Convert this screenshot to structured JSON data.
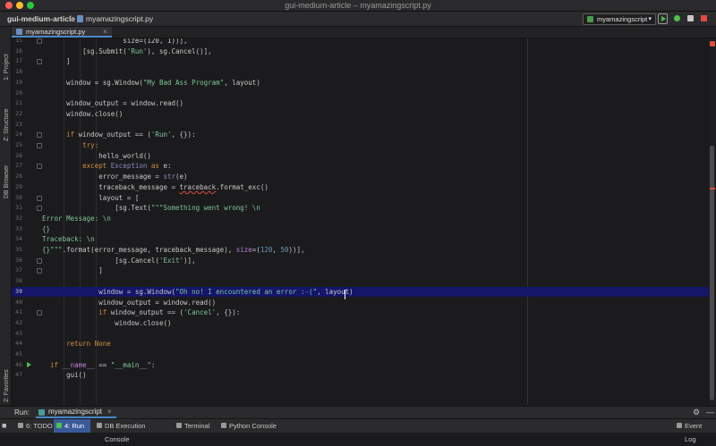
{
  "window": {
    "title": "gui-medium-article – myamazingscript.py"
  },
  "navbar": {
    "project": "gui-medium-article",
    "separator": "〉",
    "file": "myamazingscript.py",
    "run_config": "myamazingscript",
    "run_config_caret": "▾"
  },
  "left_tabs": [
    {
      "label": "1: Project",
      "icon": "folder-icon"
    },
    {
      "label": "Z: Structure",
      "icon": "structure-icon"
    },
    {
      "label": "DB Browser",
      "icon": "database-icon"
    },
    {
      "label": "2: Favorites",
      "icon": "star-icon"
    }
  ],
  "editor_tab": {
    "label": "myamazingscript.py",
    "close": "×"
  },
  "code_lines": [
    {
      "n": "15",
      "segs": [
        [
          "",
          "                    size=(120, 1))],"
        ]
      ]
    },
    {
      "n": "16",
      "segs": [
        [
          "",
          "          [sg.Submit("
        ],
        [
          "str",
          "'Run'"
        ],
        [
          "",
          "), sg.Cancel()],"
        ]
      ]
    },
    {
      "n": "17",
      "segs": [
        [
          "",
          "      ]"
        ]
      ]
    },
    {
      "n": "18",
      "segs": []
    },
    {
      "n": "19",
      "segs": [
        [
          "",
          "      window = sg.Window("
        ],
        [
          "str",
          "\"My Bad Ass Program\""
        ],
        [
          "",
          ", layout)"
        ]
      ]
    },
    {
      "n": "20",
      "segs": []
    },
    {
      "n": "21",
      "segs": [
        [
          "",
          "      window_output = window.read()"
        ]
      ]
    },
    {
      "n": "22",
      "segs": [
        [
          "",
          "      window.close()"
        ]
      ]
    },
    {
      "n": "23",
      "segs": []
    },
    {
      "n": "24",
      "segs": [
        [
          "kw",
          "      if "
        ],
        [
          "",
          "window_output == ("
        ],
        [
          "str",
          "'Run'"
        ],
        [
          "",
          ", {}):"
        ]
      ]
    },
    {
      "n": "25",
      "segs": [
        [
          "kw",
          "          try:"
        ]
      ]
    },
    {
      "n": "26",
      "segs": [
        [
          "",
          "              hello_world()"
        ]
      ]
    },
    {
      "n": "27",
      "segs": [
        [
          "kw",
          "          except "
        ],
        [
          "builtin",
          "Exception"
        ],
        [
          "kw",
          " as "
        ],
        [
          "",
          "e:"
        ]
      ]
    },
    {
      "n": "28",
      "segs": [
        [
          "",
          "              error_message = "
        ],
        [
          "builtin",
          "str"
        ],
        [
          "",
          "(e)"
        ]
      ]
    },
    {
      "n": "29",
      "segs": [
        [
          "",
          "              traceback_message = "
        ],
        [
          "err",
          "traceback"
        ],
        [
          "",
          ".format_exc()"
        ]
      ]
    },
    {
      "n": "30",
      "segs": [
        [
          "",
          "              layout = ["
        ]
      ]
    },
    {
      "n": "31",
      "segs": [
        [
          "",
          "                  [sg.Text("
        ],
        [
          "str",
          "\"\"\"Something went wrong! \\n"
        ]
      ]
    },
    {
      "n": "32",
      "segs": [
        [
          "str",
          "Error Message: \\n"
        ]
      ]
    },
    {
      "n": "33",
      "segs": [
        [
          "str",
          "{}"
        ]
      ]
    },
    {
      "n": "34",
      "segs": [
        [
          "str",
          "Traceback: \\n"
        ]
      ]
    },
    {
      "n": "35",
      "segs": [
        [
          "str",
          "{}\"\"\""
        ],
        [
          "",
          ".format(error_message, traceback_message), "
        ],
        [
          "param",
          "size"
        ],
        [
          "",
          "=("
        ],
        [
          "num",
          "120"
        ],
        [
          "",
          ", "
        ],
        [
          "num",
          "50"
        ],
        [
          "",
          "))],"
        ]
      ]
    },
    {
      "n": "36",
      "segs": [
        [
          "",
          "                  [sg.Cancel("
        ],
        [
          "str",
          "'Exit'"
        ],
        [
          "",
          ")],"
        ]
      ]
    },
    {
      "n": "37",
      "segs": [
        [
          "",
          "              ]"
        ]
      ]
    },
    {
      "n": "38",
      "segs": []
    },
    {
      "n": "39",
      "segs": [
        [
          "",
          "              window = sg.Window("
        ],
        [
          "str",
          "\"Oh no! I encountered an error :-(\""
        ],
        [
          "",
          ", layout)"
        ]
      ]
    },
    {
      "n": "40",
      "segs": [
        [
          "",
          "              window_output = window.read()"
        ]
      ]
    },
    {
      "n": "41",
      "segs": [
        [
          "kw",
          "              if "
        ],
        [
          "",
          "window_output == ("
        ],
        [
          "str",
          "'Cancel'"
        ],
        [
          "",
          ", {}):"
        ]
      ]
    },
    {
      "n": "42",
      "segs": [
        [
          "",
          "                  window.close()"
        ]
      ]
    },
    {
      "n": "43",
      "segs": []
    },
    {
      "n": "44",
      "segs": [
        [
          "kw",
          "      return None"
        ]
      ]
    },
    {
      "n": "45",
      "segs": []
    },
    {
      "n": "46",
      "segs": [
        [
          "kw",
          "  if "
        ],
        [
          "param",
          "__name__"
        ],
        [
          "",
          " == "
        ],
        [
          "str",
          "\"__main__\""
        ],
        [
          "",
          ":"
        ]
      ]
    },
    {
      "n": "47",
      "segs": [
        [
          "",
          "      gui()"
        ]
      ]
    }
  ],
  "run_panel": {
    "label": "Run:",
    "tab": "myamazingscript",
    "close": "×",
    "gear": "⚙",
    "hide": "—"
  },
  "status": {
    "items": [
      "6: TODO",
      "4: Run",
      "DB Execution Console",
      "Terminal",
      "Python Console"
    ],
    "event_log": "Event Log"
  }
}
